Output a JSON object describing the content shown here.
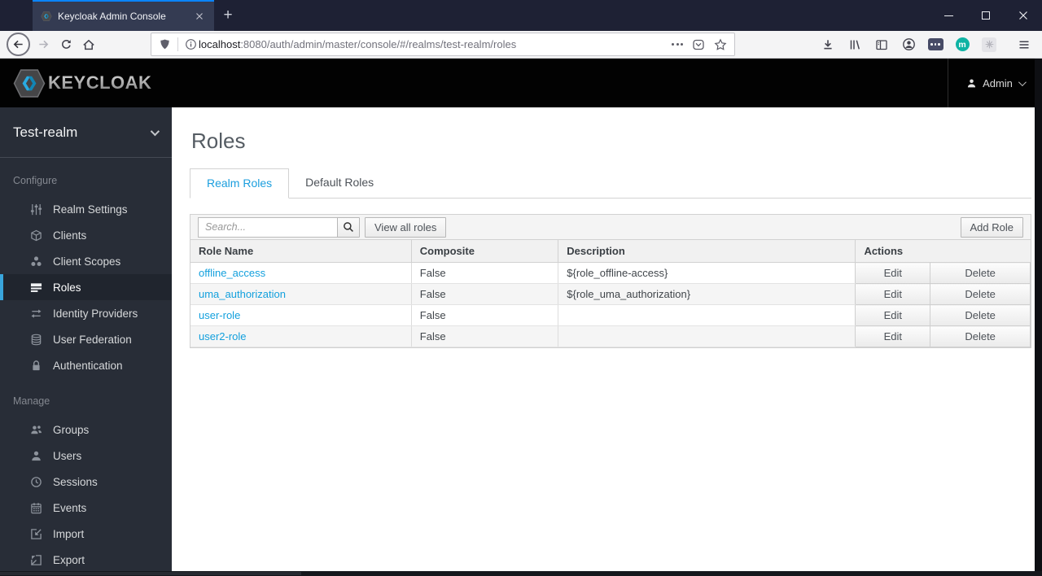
{
  "browser": {
    "tab": {
      "title": "Keycloak Admin Console",
      "new_tab_label": "+"
    },
    "url": {
      "host": "localhost",
      "path": ":8080/auth/admin/master/console/#/realms/test-realm/roles"
    },
    "extension_m_label": "m"
  },
  "header": {
    "brand": "KEYCLOAK",
    "user_label": "Admin"
  },
  "sidebar": {
    "realm_label": "Test-realm",
    "sections": [
      {
        "label": "Configure",
        "items": [
          {
            "label": "Realm Settings",
            "active": false
          },
          {
            "label": "Clients",
            "active": false
          },
          {
            "label": "Client Scopes",
            "active": false
          },
          {
            "label": "Roles",
            "active": true
          },
          {
            "label": "Identity Providers",
            "active": false
          },
          {
            "label": "User Federation",
            "active": false
          },
          {
            "label": "Authentication",
            "active": false
          }
        ]
      },
      {
        "label": "Manage",
        "items": [
          {
            "label": "Groups",
            "active": false
          },
          {
            "label": "Users",
            "active": false
          },
          {
            "label": "Sessions",
            "active": false
          },
          {
            "label": "Events",
            "active": false
          },
          {
            "label": "Import",
            "active": false
          },
          {
            "label": "Export",
            "active": false
          }
        ]
      }
    ]
  },
  "main": {
    "title": "Roles",
    "tabs": [
      {
        "label": "Realm Roles",
        "active": true
      },
      {
        "label": "Default Roles",
        "active": false
      }
    ],
    "toolbar": {
      "search_placeholder": "Search...",
      "view_all_label": "View all roles",
      "add_role_label": "Add Role"
    },
    "table": {
      "headers": [
        "Role Name",
        "Composite",
        "Description",
        "Actions"
      ],
      "action_labels": {
        "edit": "Edit",
        "delete": "Delete"
      },
      "rows": [
        {
          "name": "offline_access",
          "composite": "False",
          "description": "${role_offline-access}"
        },
        {
          "name": "uma_authorization",
          "composite": "False",
          "description": "${role_uma_authorization}"
        },
        {
          "name": "user-role",
          "composite": "False",
          "description": ""
        },
        {
          "name": "user2-role",
          "composite": "False",
          "description": ""
        }
      ]
    }
  },
  "colors": {
    "titlebar": "#1e2134",
    "tab_stripe": "#0a84ff",
    "header_bg": "#020202",
    "sidebar_bg": "#282d37",
    "sidebar_active_accent": "#39a5dc",
    "link_blue": "#13a0dd",
    "tab_active_blue": "#1b9ede",
    "teal_badge": "#0fb3a4"
  }
}
